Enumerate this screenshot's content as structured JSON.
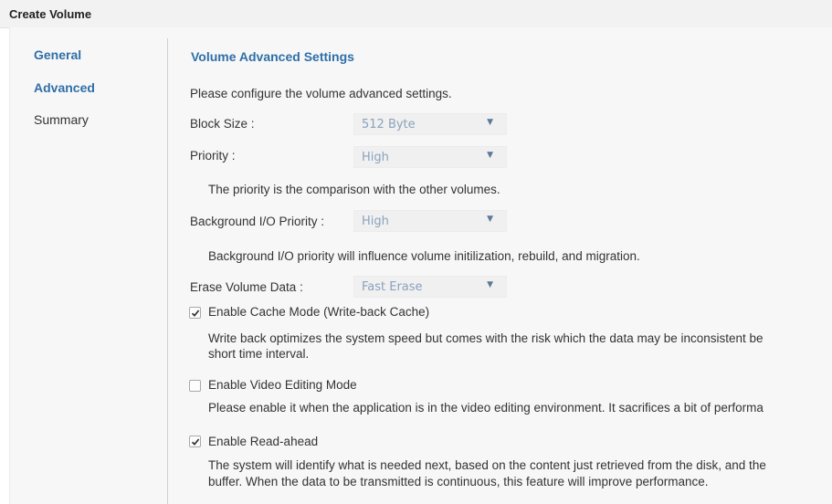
{
  "window": {
    "title": "Create Volume"
  },
  "nav": {
    "items": [
      {
        "label": "General"
      },
      {
        "label": "Advanced"
      },
      {
        "label": "Summary"
      }
    ]
  },
  "main": {
    "heading": "Volume Advanced Settings",
    "intro": "Please configure the volume advanced settings.",
    "block_size": {
      "label": "Block Size :",
      "value": "512 Byte"
    },
    "priority": {
      "label": "Priority :",
      "value": "High",
      "hint": "The priority is the comparison with the other volumes."
    },
    "bg_priority": {
      "label": "Background I/O Priority :",
      "value": "High",
      "hint": "Background I/O priority will influence volume initilization, rebuild, and migration."
    },
    "erase": {
      "label": "Erase Volume Data :",
      "value": "Fast Erase"
    },
    "cache_mode": {
      "label": "Enable Cache Mode (Write-back Cache)",
      "checked": true,
      "desc_line1": "Write back optimizes the system speed but comes with the risk which the data may be inconsistent be",
      "desc_line2": "short time interval."
    },
    "video_mode": {
      "label": "Enable Video Editing Mode",
      "checked": false,
      "desc_line1": "Please enable it when the application is in the video editing environment. It sacrifices a bit of performa"
    },
    "read_ahead": {
      "label": "Enable Read-ahead",
      "checked": true,
      "desc_line1": "The system will identify what is needed next, based on the content just retrieved from the disk, and the",
      "desc_line2": "buffer. When the data to be transmitted is continuous, this feature will improve performance."
    }
  }
}
